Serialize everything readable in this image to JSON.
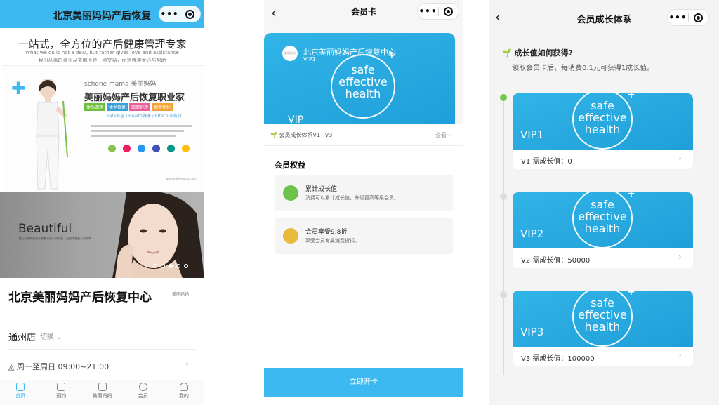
{
  "screen1": {
    "nav_title": "北京美丽妈妈产后恢复",
    "slogan": "一站式，全方位的产后健康管理专家",
    "slogan_en": "What we do is not a deal, but rather gives love and assistance",
    "slogan_cn_small": "我们从事的事业从来都不是一项交易，而是传递爱心与帮助",
    "banner1": {
      "brand": "schöne mama 美丽妈妈",
      "title": "美丽妈妈产后恢复职业家",
      "tags": [
        {
          "label": "体质调理",
          "color": "#6cbf3a"
        },
        {
          "label": "体型恢复",
          "color": "#3aa0d8"
        },
        {
          "label": "面部护理",
          "color": "#e85f9a"
        },
        {
          "label": "胸型优化",
          "color": "#f2a33a"
        }
      ],
      "safe_line": "Safe安全 / Health健康 / Effective有效",
      "icon_colors": [
        "#8bc34a",
        "#e91e63",
        "#2196f3",
        "#3f51b5",
        "#009688",
        "#ffc107"
      ],
      "url": "www.meilimama.com"
    },
    "banner2": {
      "headline": "Beautiful",
      "subline": "我们从事的事业从来都不是一项交易，而是传递爱心与帮助",
      "dots": [
        false,
        false,
        true,
        false,
        false
      ]
    },
    "store_name": "北京美丽妈妈产后恢复中心",
    "store_logo": "美丽妈妈",
    "branch": "通州店",
    "switch_label": "切换",
    "hours": "周一至周日 09:00~21:00",
    "tabs": [
      {
        "label": "首页",
        "active": true
      },
      {
        "label": "预约",
        "active": false
      },
      {
        "label": "美丽妈妈",
        "active": false
      },
      {
        "label": "会员",
        "active": false
      },
      {
        "label": "我的",
        "active": false
      }
    ]
  },
  "screen2": {
    "nav_title": "会员卡",
    "card": {
      "logo_text": "美丽妈妈",
      "center_name": "北京美丽妈妈产后恢复中心",
      "level": "VIP1",
      "ring_words": [
        "safe",
        "effective",
        "health"
      ],
      "partial_level": "VIP"
    },
    "growth_link": "会员成长体系V1~V3",
    "see_label": "查看",
    "rights_title": "会员权益",
    "rights": [
      {
        "title": "累计成长值",
        "desc": "消费可以累计成长值，升级更高等级会员。",
        "icon_color": "#6cc24a",
        "icon": "sprout-icon"
      },
      {
        "title": "会员享受9.8折",
        "desc": "享受会员专属消费折扣。",
        "icon_color": "#e8b93a",
        "icon": "percent-icon"
      }
    ],
    "open_button": "立即开卡"
  },
  "screen3": {
    "nav_title": "会员成长体系",
    "question": "成长值如何获得?",
    "description": "领取会员卡后，每消费0.1元可获得1成长值。",
    "levels": [
      {
        "level": "VIP1",
        "requirement": "V1 需成长值：0",
        "active": true
      },
      {
        "level": "VIP2",
        "requirement": "V2 需成长值：50000",
        "active": false
      },
      {
        "level": "VIP3",
        "requirement": "V3 需成长值：100000",
        "active": false
      }
    ],
    "ring_words": [
      "safe",
      "effective",
      "health"
    ]
  },
  "capsule": {
    "more": "•••"
  },
  "colors": {
    "accent": "#3cb9f0",
    "card": "#2aa9e2",
    "green": "#72c84c"
  }
}
